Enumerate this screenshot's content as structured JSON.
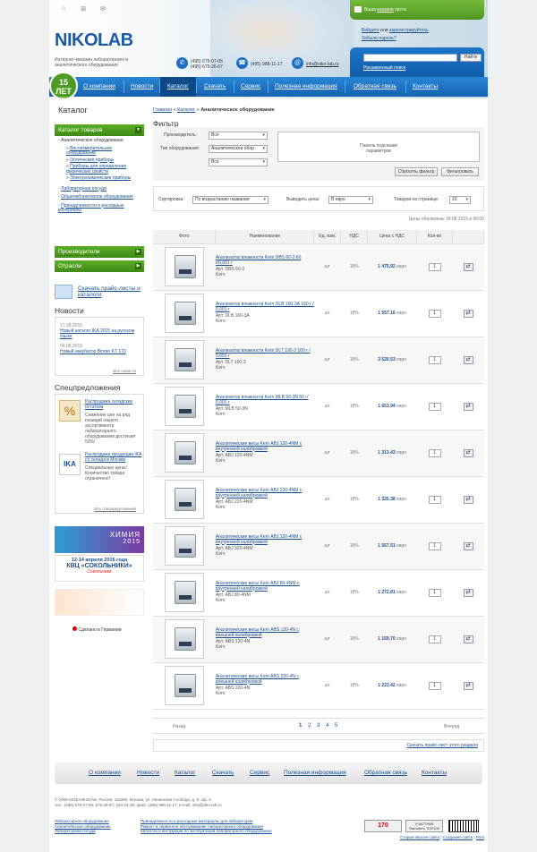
{
  "header": {
    "icons": [
      "home-icon",
      "sitemap-icon",
      "mail-icon"
    ],
    "logo_text": "NIKOLAB",
    "tagline": "Интернет-магазин лабораторного и аналитического оборудования",
    "phone1": "(495) 675-07-05",
    "phone2": "(495) 675-26-67",
    "phone3": "(495) 988-11-17",
    "email": "info@niko-lab.ru",
    "badge_years": "15 ЛЕТ",
    "badge_sub": "В РОССИИ"
  },
  "basket": {
    "pre": "Ваша ",
    "link": "корзина",
    "post": " пуста"
  },
  "auth": {
    "login": "Войдите",
    "or": " или ",
    "register": "зарегистрируйтесь",
    "forgot": "Забыли пароль?",
    "search_btn": "Найти",
    "ext_search": "Расширенный поиск"
  },
  "nav": {
    "items": [
      "О компании",
      "Новости",
      "Каталог",
      "Скачать",
      "Сервис",
      "Полезная информация",
      "Обратная связь",
      "Контакты"
    ]
  },
  "sidebar": {
    "title": "Каталог",
    "catalog_btn": "Каталог товаров",
    "tree": {
      "root": "Аналитическое оборудование",
      "sub": [
        "Весоизмерительное оборудование",
        "Оптические приборы",
        "Приборы для определения физических свойств",
        "Электрохимические приборы"
      ],
      "others": [
        "Лабораторная посуда",
        "Общелабораторное оборудование",
        "Принадлежности и расходные материалы"
      ]
    },
    "producers": "Производители",
    "industries": "Отрасли",
    "download": "Скачать прайс-листы и каталоги",
    "news_title": "Новости",
    "news": [
      {
        "date": "17.08.2015",
        "text": "Новый каталог IKA 2015 на русском языке"
      },
      {
        "date": "04.08.2015",
        "text": "Новый инкубатор Binder KT 170"
      }
    ],
    "news_all": "Все новости",
    "specials_title": "Спецпредложения",
    "specials": [
      {
        "title": "Распродажа складских остатков",
        "text": "Снижение цен на ряд позиций нашего ассортимента лабораторного оборудования достигает 50%!",
        "icon": "%"
      },
      {
        "title": "Распродажа продукции IKA со склада в Москве",
        "text": "Специальные цены! Количество товара ограничено!",
        "icon": "IKA"
      }
    ],
    "specials_all": "Все спецпредложения",
    "banner1_title": "ХИМИЯ",
    "banner1_year": "2015",
    "banner2_date": "12-14 апреля 2016 года",
    "banner2_title": "КВЦ «СОКОЛЬНИКИ»",
    "banner2_sub": "Сокольники",
    "made_in": "Сделано в Германии"
  },
  "breadcrumb": {
    "home": "Главная",
    "catalog": "Каталог",
    "current": "Аналитическое оборудование",
    "sep": "»"
  },
  "filter": {
    "title": "Фильтр",
    "producer_label": "Производитель:",
    "producer_value": "Все",
    "type_label": "Тип оборудования:",
    "type_value": "Аналитическое обор",
    "type_value2": "Все",
    "hint": "Панель подсказки параметров",
    "reset": "Сбросить фильтр",
    "apply": "Фильтровать"
  },
  "sort": {
    "label": "Сортировка:",
    "value": "По возрастанию названия",
    "currency_label": "Выводить цены:",
    "currency_value": "В евро",
    "perpage_label": "Товаров на странице:",
    "perpage_value": "10",
    "updated": "Цены обновлены 18.08.2015 в 00:00"
  },
  "table": {
    "headers": [
      "Фото",
      "Наименование",
      "Ед. изм.",
      "НДС",
      "Цена с НДС",
      "Кол-во",
      ""
    ],
    "rows": [
      {
        "name": "Анализатор влажности Kern DBS 60-3 60 г/0,001 г",
        "art": "Арт. DBS 60-3",
        "brand": "Kern",
        "unit": "шт",
        "vat": "18%",
        "price": "1 475.92",
        "cur": "евро",
        "qty": "1"
      },
      {
        "name": "Анализатор влажности Kern DLB 160-3А 160 г / 0,001 г",
        "art": "Арт. DLB 160-3A",
        "brand": "Kern",
        "unit": "шт",
        "vat": "18%",
        "price": "1 557.16",
        "cur": "евро",
        "qty": "1"
      },
      {
        "name": "Анализатор влажности Kern DLT 100-3 160 г / 0,001 г",
        "art": "Арт. DLT 100-3",
        "brand": "Kern",
        "unit": "шт",
        "vat": "18%",
        "price": "3 520.53",
        "cur": "евро",
        "qty": "1"
      },
      {
        "name": "Анализатор влажности Kern MLB 50-3N 50 г/ 0,001 г",
        "art": "Арт. MLB 50-3N",
        "brand": "Kern",
        "unit": "шт",
        "vat": "18%",
        "price": "1 651.94",
        "cur": "евро",
        "qty": "1"
      },
      {
        "name": "Аналитические весы Kern ABJ 120-4NM с внутренней калибровкой",
        "art": "Арт. ABJ 120-4NM",
        "brand": "Kern",
        "unit": "шт",
        "vat": "18%",
        "price": "1 313.43",
        "cur": "евро",
        "qty": "1"
      },
      {
        "name": "Аналитические весы Kern ABJ 220-4NM с внутренней калибровкой",
        "art": "Арт. ABJ 220-4NM",
        "brand": "Kern",
        "unit": "шт",
        "vat": "18%",
        "price": "1 325.38",
        "cur": "евро",
        "qty": "1"
      },
      {
        "name": "Аналитические весы Kern ABJ 320-4NM с внутренней калибровкой",
        "art": "Арт. ABJ 320-4NM",
        "brand": "Kern",
        "unit": "шт",
        "vat": "18%",
        "price": "1 567.51",
        "cur": "евро",
        "qty": "1"
      },
      {
        "name": "Аналитические весы Kern ABJ 80-4NM с внутренней калибровкой",
        "art": "Арт. ABJ 80-4NM",
        "brand": "Kern",
        "unit": "шт",
        "vat": "18%",
        "price": "1 272.81",
        "cur": "евро",
        "qty": "1"
      },
      {
        "name": "Аналитические весы Kern ABS 120-4N с внешней калибровкой",
        "art": "Арт. ABS 120-4N",
        "brand": "Kern",
        "unit": "шт",
        "vat": "18%",
        "price": "1 159.70",
        "cur": "евро",
        "qty": "1"
      },
      {
        "name": "Аналитические весы Kern ABS 220-4N с внешней калибровкой",
        "art": "Арт. ABS 220-4N",
        "brand": "Kern",
        "unit": "шт",
        "vat": "18%",
        "price": "1 223.42",
        "cur": "евро",
        "qty": "1"
      }
    ]
  },
  "pager": {
    "prev": "Назад",
    "pages": [
      "1",
      "2",
      "3",
      "4",
      "5"
    ],
    "current": "1",
    "next": "Вперед"
  },
  "download_price": "Скачать прайс-лист этого раздела",
  "footer": {
    "nav": [
      "О компании",
      "Новости",
      "Каталог",
      "Скачать",
      "Сервис",
      "Полезная информация",
      "Обратная связь",
      "Контакты"
    ],
    "copyright": "© 2009-2015 NIKOLAB, Россия, 115280, Москва, ул. Ленинская Слобода, д. 9, оф. 9",
    "contacts": "тел.: (495) 675-07-05, 675-26-67, 234-34-35; факс: (495) 988-11-17; e-mail: info@niko-lab.ru",
    "links_col1": [
      "Лабораторное оборудование",
      "Аналитическое оборудование",
      "Лабораторная посуда"
    ],
    "links_col2": [
      "Принадлежности и расходные материалы для лаборатории",
      "Ремонт и сервисное обслуживание лабораторного оборудования",
      "Каталоги и инструкции по эксплуатации лабораторного оборудования"
    ],
    "counters": [
      "170",
      "УЧАСТНИК Rambler's TOP100"
    ],
    "bottom_links": [
      "Старая версия сайта",
      "Создание сайта",
      "Print"
    ]
  }
}
